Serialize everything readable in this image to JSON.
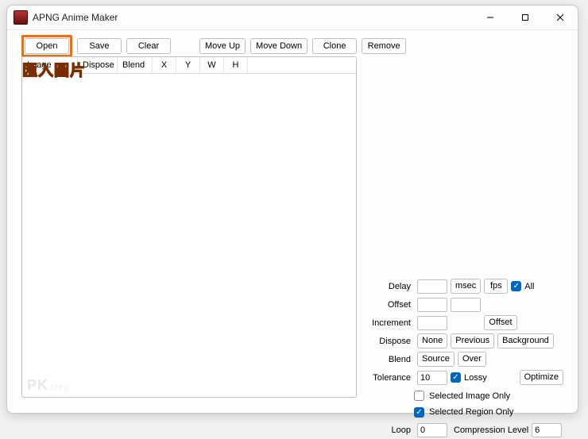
{
  "window": {
    "title": "APNG Anime Maker"
  },
  "toolbar": {
    "open": "Open",
    "save": "Save",
    "clear": "Clear",
    "move_up": "Move Up",
    "move_down": "Move Down",
    "clone": "Clone",
    "remove": "Remove"
  },
  "columns": {
    "image": "Image",
    "dispose": "Dispose",
    "blend": "Blend",
    "x": "X",
    "y": "Y",
    "w": "W",
    "h": "H"
  },
  "annotation": "匯入圖片",
  "watermark": {
    "main": "PK",
    "sub": "step"
  },
  "settings": {
    "delay_label": "Delay",
    "delay_value": "",
    "msec": "msec",
    "fps": "fps",
    "all_label": "All",
    "all_checked": true,
    "offset_label": "Offset",
    "offset_x": "",
    "offset_y": "",
    "increment_label": "Increment",
    "increment_value": "",
    "offset_btn": "Offset",
    "dispose_label": "Dispose",
    "dispose_none": "None",
    "dispose_previous": "Previous",
    "dispose_background": "Background",
    "blend_label": "Blend",
    "blend_source": "Source",
    "blend_over": "Over",
    "tolerance_label": "Tolerance",
    "tolerance_value": "10",
    "lossy_label": "Lossy",
    "lossy_checked": true,
    "optimize": "Optimize",
    "sel_image_only": "Selected Image Only",
    "sel_image_checked": false,
    "sel_region_only": "Selected Region Only",
    "sel_region_checked": true,
    "loop_label": "Loop",
    "loop_value": "0",
    "compression_label": "Compression Level",
    "compression_value": "6"
  }
}
